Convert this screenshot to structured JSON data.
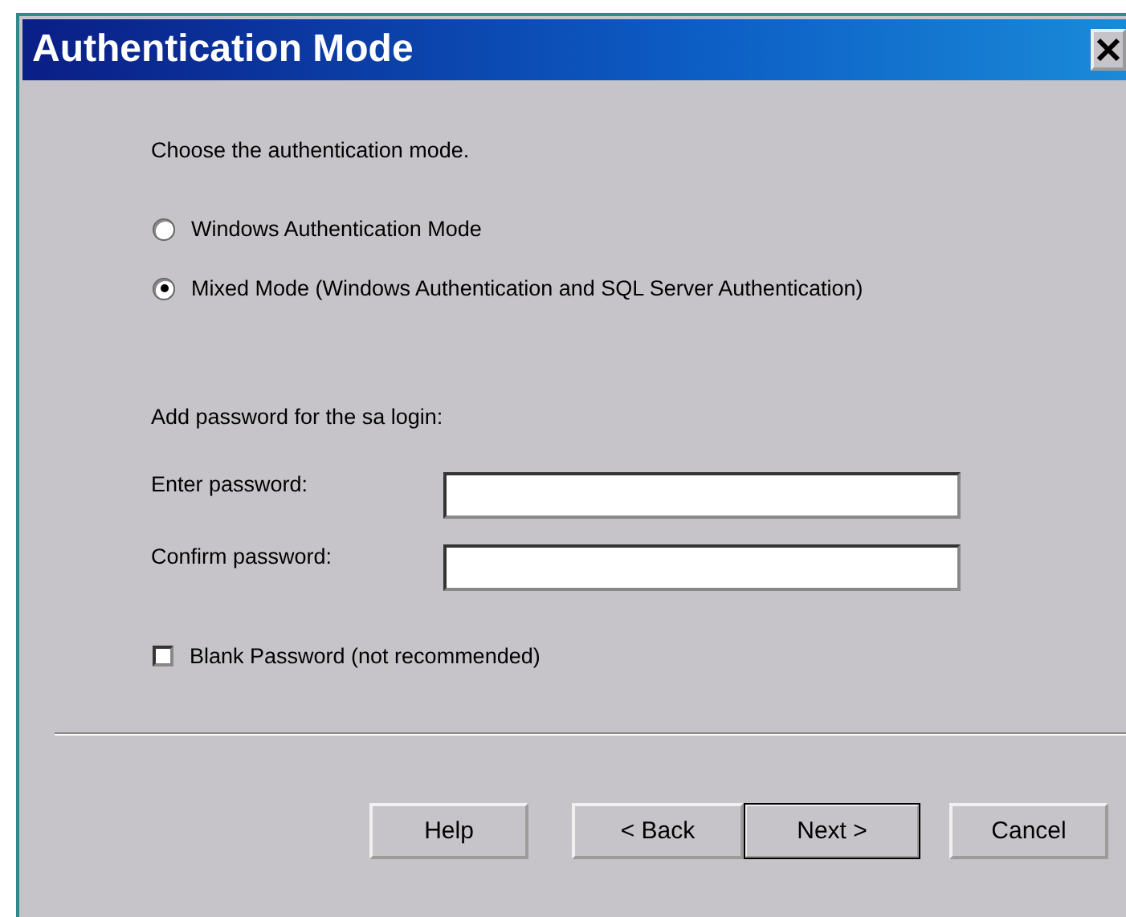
{
  "window": {
    "title": "Authentication Mode"
  },
  "prompt": "Choose the authentication mode.",
  "modes": [
    {
      "label": "Windows Authentication Mode",
      "selected": false
    },
    {
      "label": "Mixed Mode (Windows Authentication and SQL Server Authentication)",
      "selected": true
    }
  ],
  "password_heading": "Add password for the sa login:",
  "fields": [
    {
      "label": "Enter password:"
    },
    {
      "label": "Confirm password:"
    }
  ],
  "blank_password": {
    "label": "Blank Password (not recommended)",
    "checked": false
  },
  "buttons": [
    {
      "label": "Help",
      "default": false
    },
    {
      "label": "< Back",
      "default": false
    },
    {
      "label": "Next >",
      "default": true
    },
    {
      "label": "Cancel",
      "default": false
    }
  ]
}
